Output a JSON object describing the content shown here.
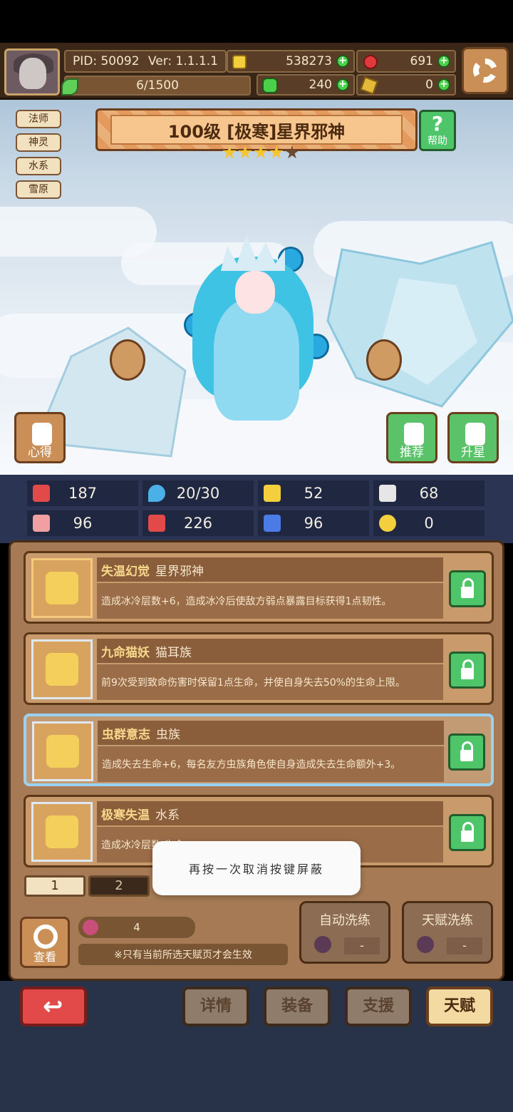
{
  "header": {
    "pid": "PID: 50092",
    "version": "Ver: 1.1.1.1",
    "coins": "538273",
    "gems": "691",
    "exp": "6/1500",
    "clovers": "240",
    "keys": "0"
  },
  "tags": [
    "法师",
    "神灵",
    "水系",
    "雪原"
  ],
  "hero": {
    "title": "100级 [极寒]星界邪神",
    "stars_filled": 4,
    "stars_total": 5
  },
  "buttons": {
    "help": "帮助",
    "xinde": "心得",
    "tuijian": "推荐",
    "shengxing": "升星",
    "search": "查看"
  },
  "stats": [
    {
      "icon": "heart-icon",
      "value": "187",
      "color": "#e24a4a"
    },
    {
      "icon": "drop-icon",
      "value": "20/30",
      "color": "#4ab0e6"
    },
    {
      "icon": "shield-icon",
      "value": "52",
      "color": "#f3cf3d"
    },
    {
      "icon": "wing-icon",
      "value": "68",
      "color": "#e6e6e6"
    },
    {
      "icon": "fist-icon",
      "value": "96",
      "color": "#f0a0a0"
    },
    {
      "icon": "book-icon",
      "value": "226",
      "color": "#e24a4a"
    },
    {
      "icon": "scroll-icon",
      "value": "96",
      "color": "#4a7be6"
    },
    {
      "icon": "clock-icon",
      "value": "0",
      "color": "#f3cf3d"
    }
  ],
  "talents": [
    {
      "name": "失温幻觉",
      "tag": "星界邪神",
      "desc": "造成冰冷层数+6，造成冰冷后使敌方弱点暴露目标获得1点韧性。"
    },
    {
      "name": "九命猫妖",
      "tag": "猫耳族",
      "desc": "前9次受到致命伤害时保留1点生命，并使自身失去50%的生命上限。"
    },
    {
      "name": "虫群意志",
      "tag": "虫族",
      "desc": "造成失去生命+6，每名友方虫族角色使自身造成失去生命额外+3。"
    },
    {
      "name": "极寒失温",
      "tag": "水系",
      "desc": "造成冰冷层数                                              生命。"
    }
  ],
  "pages": [
    "1",
    "2"
  ],
  "toast": "再按一次取消按键屏蔽",
  "potion_count": "4",
  "note": "※只有当前所选天赋页才会生效",
  "wash": {
    "auto_label": "自动洗练",
    "auto_value": "-",
    "talent_label": "天赋洗练",
    "talent_value": "-"
  },
  "nav": {
    "details": "详情",
    "equip": "装备",
    "support": "支援",
    "talent": "天赋"
  }
}
